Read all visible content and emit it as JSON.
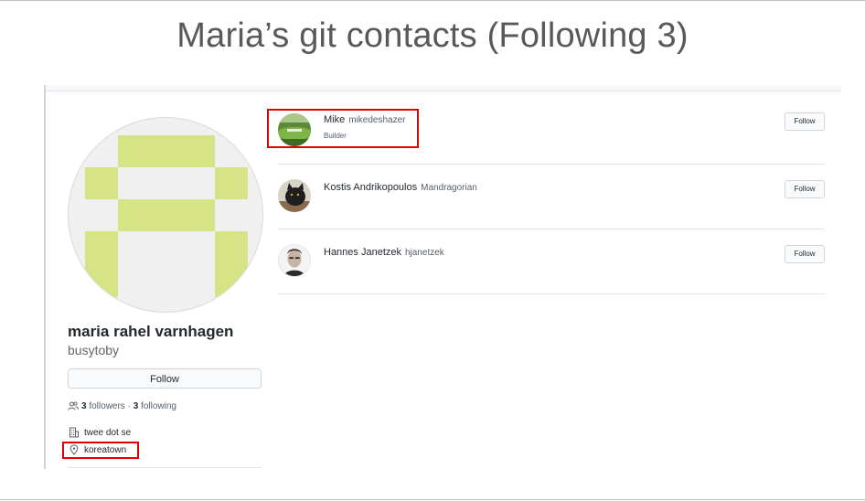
{
  "slide": {
    "title": "Maria’s git contacts (Following 3)"
  },
  "profile": {
    "name": "maria rahel varnhagen",
    "login": "busytoby",
    "follow_label": "Follow",
    "followers_count": "3",
    "followers_label": "followers",
    "separator": "·",
    "following_count": "3",
    "following_label": "following",
    "company": "twee dot se",
    "location": "koreatown",
    "identicon_color": "#d6e485"
  },
  "following": [
    {
      "name": "Mike",
      "login": "mikedeshazer",
      "bio": "Builder",
      "follow_label": "Follow"
    },
    {
      "name": "Kostis Andrikopoulos",
      "login": "Mandragorian",
      "bio": "",
      "follow_label": "Follow"
    },
    {
      "name": "Hannes Janetzek",
      "login": "hjanetzek",
      "bio": "",
      "follow_label": "Follow"
    }
  ],
  "highlight_color": "#e00000"
}
